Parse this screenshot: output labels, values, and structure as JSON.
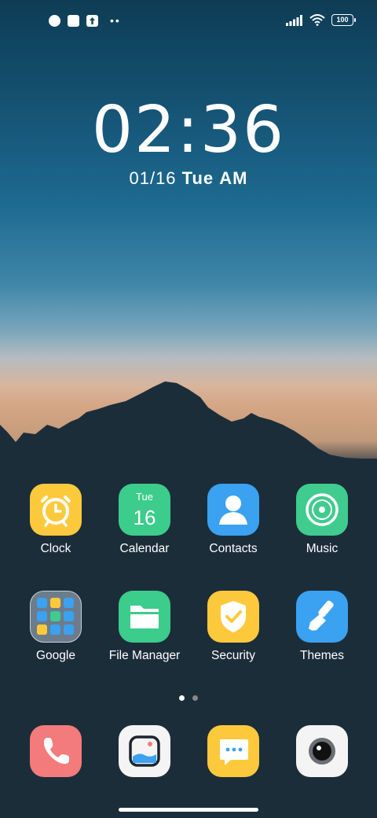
{
  "status_bar": {
    "battery": "100",
    "left_icons": [
      "app-notification-icon",
      "square-notification-icon",
      "upload-icon",
      "more-dots-icon"
    ],
    "right_icons": [
      "signal-icon",
      "wifi-icon",
      "battery-icon"
    ]
  },
  "lock": {
    "time": "02:36",
    "date": "01/16",
    "weekday": "Tue",
    "ampm": "AM"
  },
  "apps_row1": [
    {
      "label": "Clock",
      "icon": "clock-icon",
      "color": "#fcc93c"
    },
    {
      "label": "Calendar",
      "icon": "calendar-icon",
      "color": "#3ccc8c",
      "day": "Tue",
      "date": "16"
    },
    {
      "label": "Contacts",
      "icon": "contacts-icon",
      "color": "#3aa2f0"
    },
    {
      "label": "Music",
      "icon": "music-icon",
      "color": "#3fcc8e"
    }
  ],
  "apps_row2": [
    {
      "label": "Google",
      "icon": "google-folder-icon",
      "color": "#8b9aa8"
    },
    {
      "label": "File Manager",
      "icon": "folder-icon",
      "color": "#3ccc8c"
    },
    {
      "label": "Security",
      "icon": "shield-icon",
      "color": "#fcc93c"
    },
    {
      "label": "Themes",
      "icon": "brush-icon",
      "color": "#3aa2f0"
    }
  ],
  "dock": [
    {
      "icon": "phone-icon",
      "color": "#f47b7b"
    },
    {
      "icon": "gallery-icon",
      "color": "#f4f4f4"
    },
    {
      "icon": "messages-icon",
      "color": "#fcc93c"
    },
    {
      "icon": "camera-icon",
      "color": "#f4f4f4"
    }
  ],
  "pages": {
    "count": 2,
    "current": 1
  }
}
